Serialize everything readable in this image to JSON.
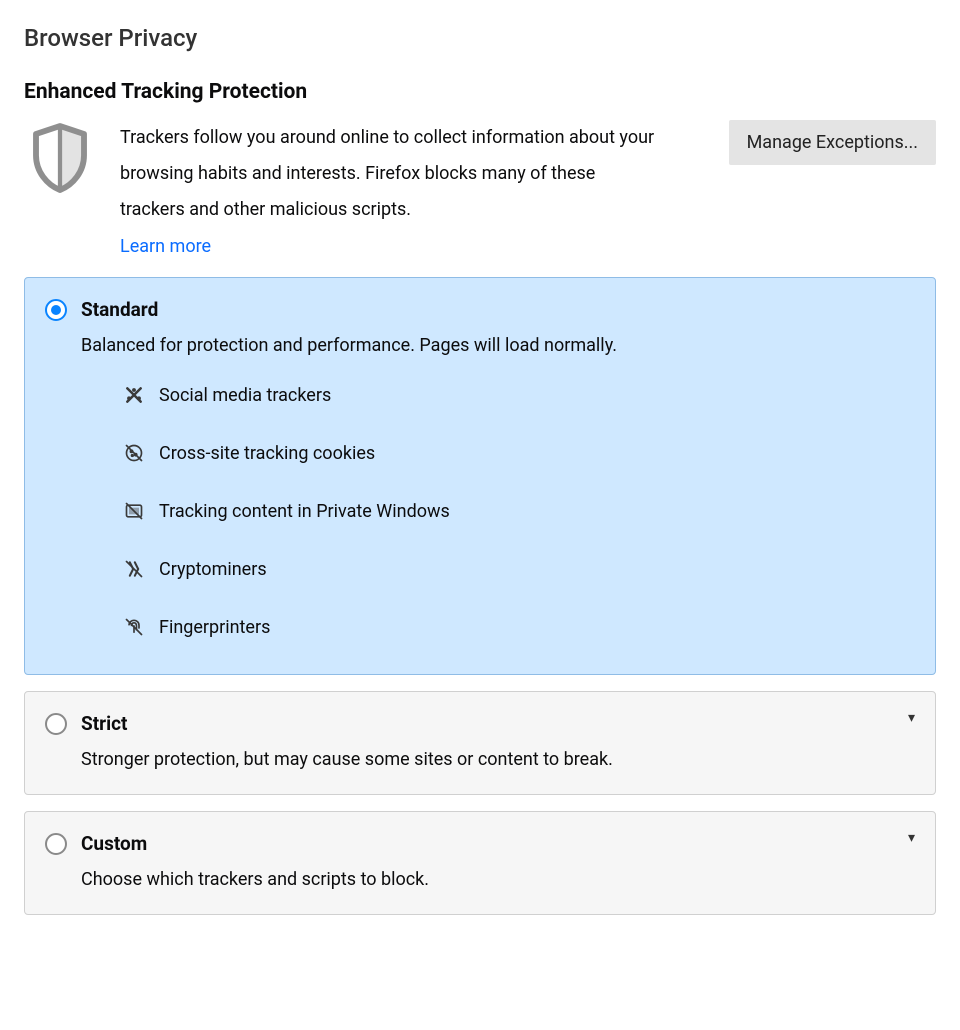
{
  "page": {
    "title": "Browser Privacy"
  },
  "section": {
    "title": "Enhanced Tracking Protection",
    "description": "Trackers follow you around online to collect information about your browsing habits and interests. Firefox blocks many of these trackers and other malicious scripts.",
    "learn_more_label": "Learn more",
    "manage_exceptions_label": "Manage Exceptions..."
  },
  "options": {
    "standard": {
      "title": "Standard",
      "description": "Balanced for protection and performance. Pages will load normally.",
      "selected": true,
      "features": [
        {
          "icon": "social-icon",
          "label": "Social media trackers"
        },
        {
          "icon": "cookie-icon",
          "label": "Cross-site tracking cookies"
        },
        {
          "icon": "private-icon",
          "label": "Tracking content in Private Windows"
        },
        {
          "icon": "crypto-icon",
          "label": "Cryptominers"
        },
        {
          "icon": "fingerprint-icon",
          "label": "Fingerprinters"
        }
      ]
    },
    "strict": {
      "title": "Strict",
      "description": "Stronger protection, but may cause some sites or content to break.",
      "selected": false
    },
    "custom": {
      "title": "Custom",
      "description": "Choose which trackers and scripts to block.",
      "selected": false
    }
  }
}
